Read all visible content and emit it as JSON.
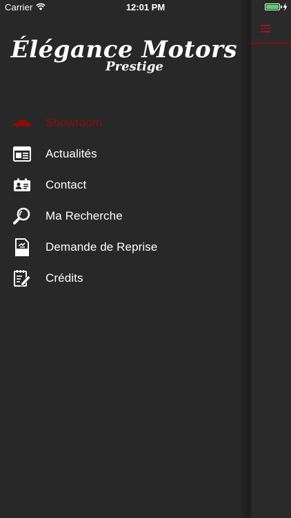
{
  "status_bar": {
    "carrier": "Carrier",
    "time": "12:01 PM",
    "wifi_icon": "wifi-icon",
    "battery_icon": "battery-icon",
    "battery_level": 1.0,
    "charging_icon": "charging-bolt-icon"
  },
  "logo": {
    "title": "Élégance Motors",
    "subtitle": "Prestige"
  },
  "menu": {
    "items": [
      {
        "label": "Showroom",
        "icon": "car-icon",
        "active": true
      },
      {
        "label": "Actualités",
        "icon": "newspaper-icon",
        "active": false
      },
      {
        "label": "Contact",
        "icon": "contact-card-icon",
        "active": false
      },
      {
        "label": "Ma Recherche",
        "icon": "magnifier-icon",
        "active": false
      },
      {
        "label": "Demande de Reprise",
        "icon": "document-icon",
        "active": false
      },
      {
        "label": "Crédits",
        "icon": "edit-document-icon",
        "active": false
      }
    ]
  },
  "main_peek": {
    "menu_button_icon": "hamburger-menu-icon"
  },
  "colors": {
    "background": "#2b2b2b",
    "drawer": "#282828",
    "accent": "#8e0c0c",
    "text": "#ffffff",
    "battery": "#4cd964"
  }
}
